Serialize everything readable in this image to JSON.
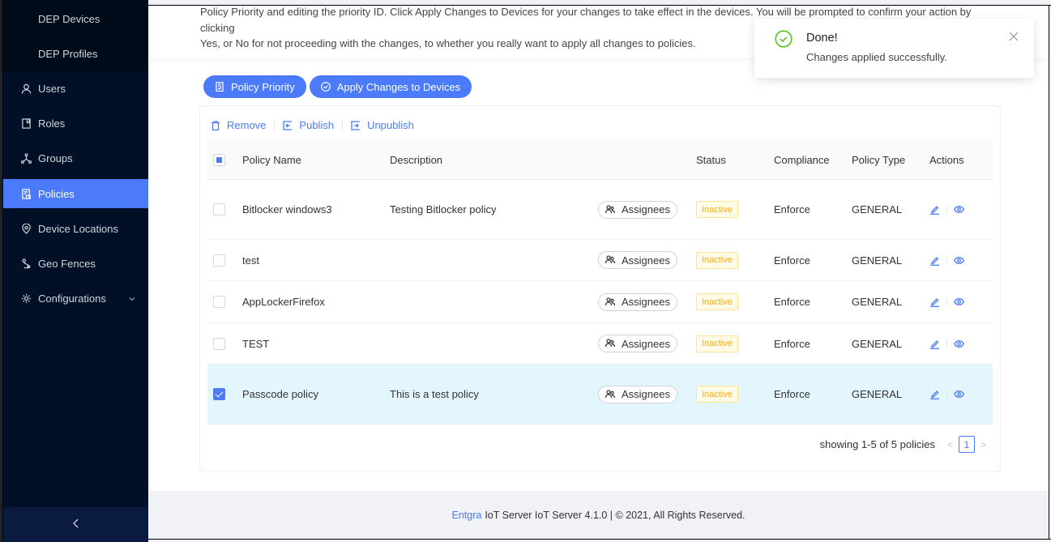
{
  "sidebar": {
    "sub_items": [
      {
        "label": "DEP Devices"
      },
      {
        "label": "DEP Profiles"
      }
    ],
    "items": [
      {
        "label": "Users",
        "icon": "user-icon"
      },
      {
        "label": "Roles",
        "icon": "book-icon"
      },
      {
        "label": "Groups",
        "icon": "cluster-icon"
      },
      {
        "label": "Policies",
        "icon": "policy-icon",
        "active": true
      },
      {
        "label": "Device Locations",
        "icon": "location-icon"
      },
      {
        "label": "Geo Fences",
        "icon": "geo-fence-icon"
      },
      {
        "label": "Configurations",
        "icon": "gear-icon",
        "expandable": true
      }
    ],
    "collapse_icon": "chevron-left-icon"
  },
  "header": {
    "description_line1": "Policy Priority and editing the priority ID. Click Apply Changes to Devices for your changes to take effect in the devices. You will be prompted to confirm your action by clicking",
    "description_line2": "Yes, or No for not proceeding with the changes, to whether you really want to apply all changes to policies."
  },
  "actions": {
    "policy_priority": "Policy Priority",
    "apply_changes": "Apply Changes to Devices"
  },
  "toolbar": {
    "remove": "Remove",
    "publish": "Publish",
    "unpublish": "Unpublish"
  },
  "table": {
    "columns": [
      "Policy Name",
      "Description",
      "Status",
      "Compliance",
      "Policy Type",
      "Actions"
    ],
    "assignees_label": "Assignees",
    "rows": [
      {
        "name": "Bitlocker windows3",
        "description": "Testing Bitlocker policy",
        "status": "Inactive",
        "compliance": "Enforce",
        "type": "GENERAL",
        "checked": false
      },
      {
        "name": "test",
        "description": "",
        "status": "Inactive",
        "compliance": "Enforce",
        "type": "GENERAL",
        "checked": false
      },
      {
        "name": "AppLockerFirefox",
        "description": "",
        "status": "Inactive",
        "compliance": "Enforce",
        "type": "GENERAL",
        "checked": false
      },
      {
        "name": "TEST",
        "description": "",
        "status": "Inactive",
        "compliance": "Enforce",
        "type": "GENERAL",
        "checked": false
      },
      {
        "name": "Passcode policy",
        "description": "This is a test policy",
        "status": "Inactive",
        "compliance": "Enforce",
        "type": "GENERAL",
        "checked": true
      }
    ]
  },
  "pagination": {
    "summary": "showing 1-5 of 5 policies",
    "current_page": "1",
    "prev": "<",
    "next": ">"
  },
  "footer": {
    "brand": "Entgra",
    "text": "IoT Server IoT Server 4.1.0 | © 2021, All Rights Reserved."
  },
  "toast": {
    "title": "Done!",
    "message": "Changes applied successfully.",
    "icon": "check-circle-icon"
  },
  "colors": {
    "accent": "#4b7bfa",
    "sidebar_bg": "#011026",
    "selected_row": "#e3f6fd",
    "status_inactive": "#faad14",
    "success": "#52c41a"
  }
}
